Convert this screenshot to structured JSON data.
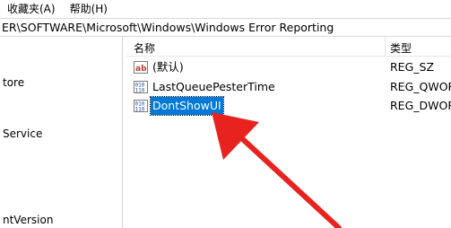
{
  "menubar": {
    "items": [
      "收藏夹(A)",
      "帮助(H)"
    ]
  },
  "address": {
    "path": "ER\\SOFTWARE\\Microsoft\\Windows\\Windows Error Reporting"
  },
  "tree": {
    "items": [
      "tore",
      "Service",
      "ntVersion"
    ]
  },
  "list": {
    "headers": {
      "name": "名称",
      "type": "类型"
    },
    "rows": [
      {
        "name": "(默认)",
        "type": "REG_SZ",
        "icon": "string-value-icon"
      },
      {
        "name": "LastQueuePesterTime",
        "type": "REG_QWOR",
        "icon": "binary-value-icon"
      },
      {
        "name": "DontShowUI",
        "type": "REG_DWOR",
        "icon": "binary-value-icon",
        "selected": true
      }
    ]
  },
  "colors": {
    "selection": "#0078d7",
    "arrow": "#e8231f"
  }
}
